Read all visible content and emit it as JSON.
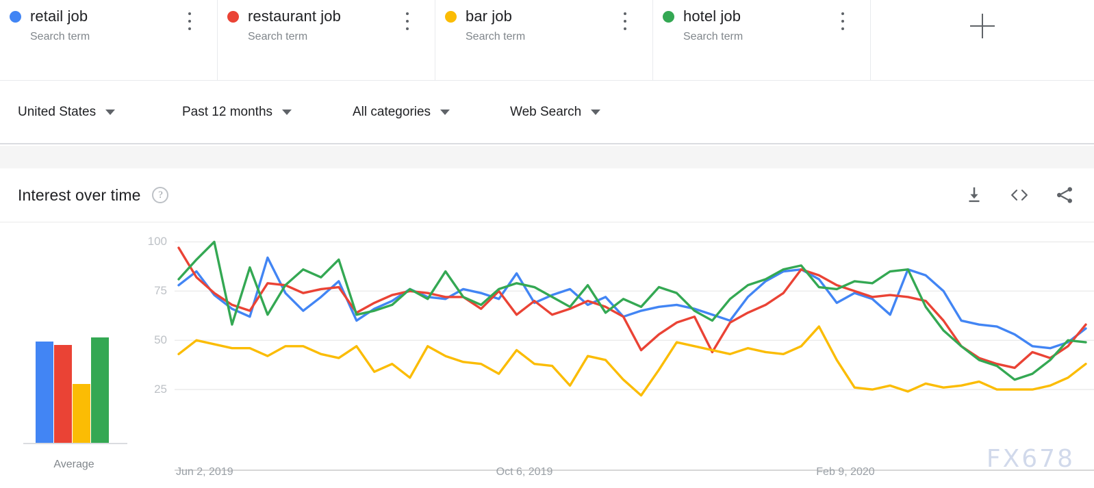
{
  "terms": [
    {
      "name": "retail job",
      "sub": "Search term",
      "color": "#4285F4",
      "menu_icon": "kebab-menu-icon"
    },
    {
      "name": "restaurant job",
      "sub": "Search term",
      "color": "#EA4335",
      "menu_icon": "kebab-menu-icon"
    },
    {
      "name": "bar job",
      "sub": "Search term",
      "color": "#FBBC04",
      "menu_icon": "kebab-menu-icon"
    },
    {
      "name": "hotel job",
      "sub": "Search term",
      "color": "#34A853",
      "menu_icon": "kebab-menu-icon"
    }
  ],
  "add_term": {
    "icon": "plus-icon",
    "label": "+"
  },
  "filters": [
    {
      "label": "United States",
      "icon": "chevron-down-icon"
    },
    {
      "label": "Past 12 months",
      "icon": "chevron-down-icon"
    },
    {
      "label": "All categories",
      "icon": "chevron-down-icon"
    },
    {
      "label": "Web Search",
      "icon": "chevron-down-icon"
    }
  ],
  "card": {
    "title": "Interest over time",
    "help_icon": "help-circle-icon",
    "help_label": "?",
    "actions": [
      {
        "name": "download-icon",
        "label": "Download CSV"
      },
      {
        "name": "embed-code-icon",
        "label": "Embed"
      },
      {
        "name": "share-icon",
        "label": "Share"
      }
    ]
  },
  "average_panel": {
    "label": "Average",
    "values": [
      65,
      63,
      38,
      68
    ],
    "colors": [
      "#4285F4",
      "#EA4335",
      "#FBBC04",
      "#34A853"
    ]
  },
  "watermark": "FX678",
  "chart_data": {
    "type": "line",
    "title": "Interest over time",
    "xlabel": "",
    "ylabel": "",
    "ylim": [
      0,
      105
    ],
    "yticks": [
      25,
      50,
      75,
      100
    ],
    "grid": true,
    "legend_position": "top",
    "x_tick_labels": [
      "Jun 2, 2019",
      "Oct 6, 2019",
      "Feb 9, 2020"
    ],
    "x_tick_indices": [
      0,
      18,
      36
    ],
    "x": [
      "Jun 2, 2019",
      "Jun 9, 2019",
      "Jun 16, 2019",
      "Jun 23, 2019",
      "Jun 30, 2019",
      "Jul 7, 2019",
      "Jul 14, 2019",
      "Jul 21, 2019",
      "Jul 28, 2019",
      "Aug 4, 2019",
      "Aug 11, 2019",
      "Aug 18, 2019",
      "Aug 25, 2019",
      "Sep 1, 2019",
      "Sep 8, 2019",
      "Sep 15, 2019",
      "Sep 22, 2019",
      "Sep 29, 2019",
      "Oct 6, 2019",
      "Oct 13, 2019",
      "Oct 20, 2019",
      "Oct 27, 2019",
      "Nov 3, 2019",
      "Nov 10, 2019",
      "Nov 17, 2019",
      "Nov 24, 2019",
      "Dec 1, 2019",
      "Dec 8, 2019",
      "Dec 15, 2019",
      "Dec 22, 2019",
      "Dec 29, 2019",
      "Jan 5, 2020",
      "Jan 12, 2020",
      "Jan 19, 2020",
      "Jan 26, 2020",
      "Feb 2, 2020",
      "Feb 9, 2020",
      "Feb 16, 2020",
      "Feb 23, 2020",
      "Mar 1, 2020",
      "Mar 8, 2020",
      "Mar 15, 2020",
      "Mar 22, 2020",
      "Mar 29, 2020",
      "Apr 5, 2020",
      "Apr 12, 2020",
      "Apr 19, 2020",
      "Apr 26, 2020",
      "May 3, 2020",
      "May 10, 2020",
      "May 17, 2020",
      "May 24, 2020"
    ],
    "series": [
      {
        "name": "retail job",
        "color": "#4285F4",
        "values": [
          78,
          85,
          73,
          66,
          62,
          92,
          74,
          65,
          72,
          80,
          60,
          66,
          70,
          76,
          72,
          71,
          76,
          74,
          71,
          84,
          69,
          73,
          76,
          68,
          72,
          62,
          65,
          67,
          68,
          66,
          63,
          60,
          72,
          80,
          85,
          86,
          81,
          69,
          74,
          71,
          63,
          86,
          83,
          75,
          60,
          58,
          57,
          53,
          47,
          46,
          49,
          56
        ]
      },
      {
        "name": "restaurant job",
        "color": "#EA4335",
        "values": [
          97,
          82,
          74,
          68,
          65,
          79,
          78,
          74,
          76,
          77,
          64,
          69,
          73,
          75,
          74,
          72,
          72,
          66,
          75,
          63,
          70,
          63,
          66,
          70,
          67,
          62,
          45,
          53,
          59,
          62,
          44,
          59,
          64,
          68,
          74,
          86,
          83,
          78,
          75,
          72,
          73,
          72,
          70,
          60,
          47,
          41,
          38,
          36,
          44,
          41,
          47,
          58
        ]
      },
      {
        "name": "bar job",
        "color": "#FBBC04",
        "values": [
          43,
          50,
          48,
          46,
          46,
          42,
          47,
          47,
          43,
          41,
          47,
          34,
          38,
          31,
          47,
          42,
          39,
          38,
          33,
          45,
          38,
          37,
          27,
          42,
          40,
          30,
          22,
          35,
          49,
          47,
          45,
          43,
          46,
          44,
          43,
          47,
          57,
          40,
          26,
          25,
          27,
          24,
          28,
          26,
          27,
          29,
          25,
          25,
          25,
          27,
          31,
          38
        ]
      },
      {
        "name": "hotel job",
        "color": "#34A853",
        "values": [
          81,
          91,
          100,
          58,
          87,
          63,
          78,
          86,
          82,
          91,
          63,
          65,
          68,
          76,
          71,
          85,
          72,
          68,
          76,
          79,
          77,
          72,
          67,
          78,
          64,
          71,
          67,
          77,
          74,
          65,
          60,
          71,
          78,
          81,
          86,
          88,
          77,
          76,
          80,
          79,
          85,
          86,
          67,
          55,
          47,
          40,
          37,
          30,
          33,
          40,
          50,
          49
        ]
      }
    ]
  }
}
